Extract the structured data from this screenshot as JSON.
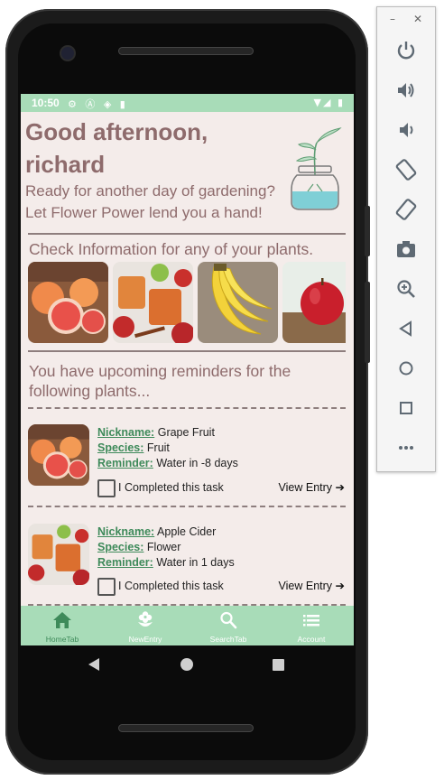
{
  "status_bar": {
    "time": "10:50"
  },
  "greeting": {
    "line1": "Good afternoon,",
    "line2": "richard"
  },
  "subtitle": {
    "line1": "Ready for another day of gardening?",
    "line2": "Let Flower Power lend you a hand!"
  },
  "info_section": {
    "title": "Check Information for any of your plants."
  },
  "carousel": [
    {
      "name": "grapefruit"
    },
    {
      "name": "apple-cider"
    },
    {
      "name": "bananas"
    },
    {
      "name": "apple"
    }
  ],
  "reminders_section": {
    "title_line1": "You have upcoming reminders for the",
    "title_line2": "following plants..."
  },
  "labels": {
    "nickname": "Nickname:",
    "species": "Species:",
    "reminder": "Reminder:",
    "completed": "I Completed this task",
    "view_entry": "View Entry"
  },
  "reminders": [
    {
      "nickname": "Grape Fruit",
      "species": "Fruit",
      "reminder": "Water in -8 days",
      "completed": false
    },
    {
      "nickname": "Apple Cider",
      "species": "Flower",
      "reminder": "Water in 1 days",
      "completed": false
    }
  ],
  "tabs": [
    {
      "label": "HomeTab",
      "icon": "home-icon",
      "active": true
    },
    {
      "label": "NewEntry",
      "icon": "flower-icon",
      "active": false
    },
    {
      "label": "SearchTab",
      "icon": "search-icon",
      "active": false
    },
    {
      "label": "Account",
      "icon": "list-icon",
      "active": false
    }
  ],
  "colors": {
    "accent": "#a8dcb8",
    "accent_dark": "#3e8a5a",
    "text": "#8e6b6c",
    "background": "#f4ecea"
  },
  "emulator_toolbar": [
    "power-icon",
    "volume-up-icon",
    "volume-down-icon",
    "rotate-left-icon",
    "rotate-right-icon",
    "camera-icon",
    "zoom-icon",
    "back-icon",
    "home-icon",
    "overview-icon",
    "more-icon"
  ]
}
